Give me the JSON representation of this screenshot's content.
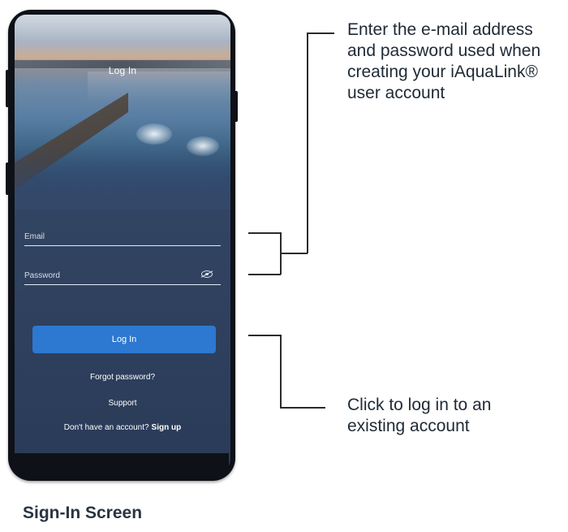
{
  "app": {
    "screen_title": "Log In"
  },
  "form": {
    "email_placeholder": "Email",
    "password_placeholder": "Password",
    "login_button_label": "Log In",
    "forgot_password_label": "Forgot password?",
    "support_label": "Support",
    "no_account_text": "Don't have an account?",
    "signup_label": "Sign up"
  },
  "annotations": {
    "credentials_note_line1": "Enter the e-mail address",
    "credentials_note_line2": "and password used when",
    "credentials_note_line3": "creating your iAquaLink®",
    "credentials_note_line4": "user account",
    "login_note_line1": "Click to log in to an",
    "login_note_line2": "existing account"
  },
  "caption": "Sign-In Screen",
  "colors": {
    "login_button": "#2d78d0",
    "screen_background": "#314462",
    "phone_frame": "#0e1117",
    "callout_text": "#1f2a36"
  },
  "icons": {
    "password_toggle": "eye-slash-icon"
  }
}
